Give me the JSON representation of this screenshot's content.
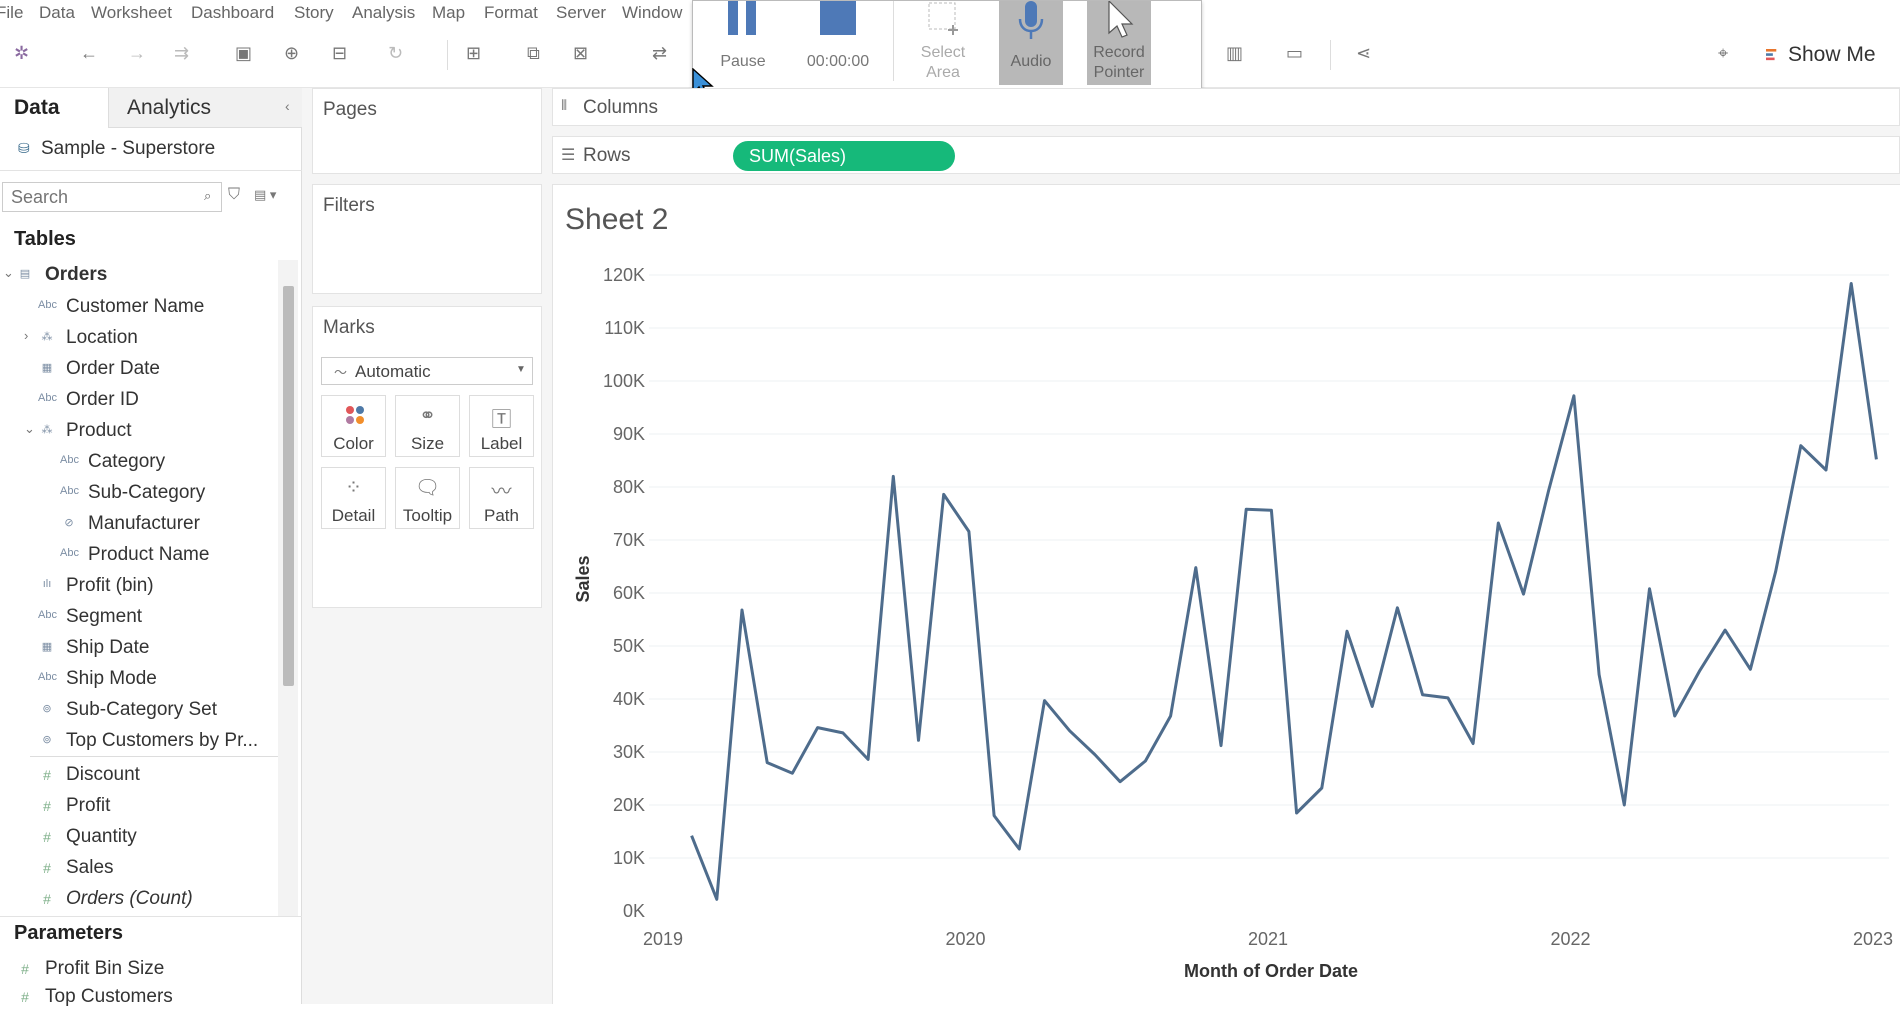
{
  "menu": [
    "File",
    "Data",
    "Worksheet",
    "Dashboard",
    "Story",
    "Analysis",
    "Map",
    "Format",
    "Server",
    "Window"
  ],
  "toolbar": {
    "show_me_label": "Show Me"
  },
  "recorder": {
    "pause_label": "Pause",
    "time": "00:00:00",
    "select_area_label": "Select Area",
    "audio_label": "Audio",
    "record_pointer_label": "Record Pointer"
  },
  "datapane": {
    "tab_data": "Data",
    "tab_analytics": "Analytics",
    "datasource": "Sample - Superstore",
    "search_placeholder": "Search",
    "tables_heading": "Tables",
    "table_name": "Orders",
    "fields": [
      {
        "label": "Customer Name",
        "icon": "Abc"
      },
      {
        "label": "Location",
        "icon": "hier"
      },
      {
        "label": "Order Date",
        "icon": "date"
      },
      {
        "label": "Order ID",
        "icon": "Abc"
      },
      {
        "label": "Product",
        "icon": "hier"
      },
      {
        "label": "Category",
        "icon": "Abc"
      },
      {
        "label": "Sub-Category",
        "icon": "Abc"
      },
      {
        "label": "Manufacturer",
        "icon": "clip"
      },
      {
        "label": "Product Name",
        "icon": "Abc"
      },
      {
        "label": "Profit (bin)",
        "icon": "bin"
      },
      {
        "label": "Segment",
        "icon": "Abc"
      },
      {
        "label": "Ship Date",
        "icon": "date"
      },
      {
        "label": "Ship Mode",
        "icon": "Abc"
      },
      {
        "label": "Sub-Category Set",
        "icon": "set"
      },
      {
        "label": "Top Customers by Pr...",
        "icon": "set"
      }
    ],
    "measures": [
      {
        "label": "Discount"
      },
      {
        "label": "Profit"
      },
      {
        "label": "Quantity"
      },
      {
        "label": "Sales"
      },
      {
        "label": "Orders (Count)"
      }
    ],
    "parameters_heading": "Parameters",
    "parameters": [
      "Profit Bin Size",
      "Top Customers"
    ]
  },
  "shelves": {
    "pages": "Pages",
    "filters": "Filters",
    "marks": "Marks",
    "mark_type": "Automatic",
    "mark_buttons": [
      "Color",
      "Size",
      "Label",
      "Detail",
      "Tooltip",
      "Path"
    ],
    "columns": "Columns",
    "rows": "Rows",
    "rows_pill": "SUM(Sales)"
  },
  "sheet": {
    "title": "Sheet 2"
  },
  "chart_data": {
    "type": "line",
    "title": "",
    "xlabel": "Month of Order Date",
    "ylabel": "Sales",
    "ylim": [
      0,
      120000
    ],
    "yticks": [
      "0K",
      "10K",
      "20K",
      "30K",
      "40K",
      "50K",
      "60K",
      "70K",
      "80K",
      "90K",
      "100K",
      "110K",
      "120K"
    ],
    "xticks": [
      "2019",
      "2020",
      "2021",
      "2022",
      "2023"
    ],
    "series": [
      {
        "color": "#4e6c8c",
        "x": [
          "2019-01",
          "2019-02",
          "2019-03",
          "2019-04",
          "2019-05",
          "2019-06",
          "2019-07",
          "2019-08",
          "2019-09",
          "2019-10",
          "2019-11",
          "2019-12",
          "2020-01",
          "2020-02",
          "2020-03",
          "2020-04",
          "2020-05",
          "2020-06",
          "2020-07",
          "2020-08",
          "2020-09",
          "2020-10",
          "2020-11",
          "2020-12",
          "2021-01",
          "2021-02",
          "2021-03",
          "2021-04",
          "2021-05",
          "2021-06",
          "2021-07",
          "2021-08",
          "2021-09",
          "2021-10",
          "2021-11",
          "2021-12",
          "2022-01",
          "2022-02",
          "2022-03",
          "2022-04",
          "2022-05",
          "2022-06",
          "2022-07",
          "2022-08",
          "2022-09",
          "2022-10",
          "2022-11",
          "2022-12"
        ],
        "values": [
          14200,
          2200,
          56800,
          28000,
          26000,
          34600,
          33600,
          28600,
          82000,
          32200,
          78600,
          71600,
          18000,
          11700,
          39700,
          34000,
          29500,
          24400,
          28300,
          36800,
          64800,
          31200,
          75800,
          75600,
          18500,
          23200,
          52800,
          38600,
          57200,
          40800,
          40200,
          31600,
          73200,
          59800,
          79400,
          97200,
          44600,
          20000,
          60800,
          36800,
          45400,
          53000,
          45600,
          64000,
          87800,
          83200,
          118400,
          85200
        ]
      }
    ]
  }
}
